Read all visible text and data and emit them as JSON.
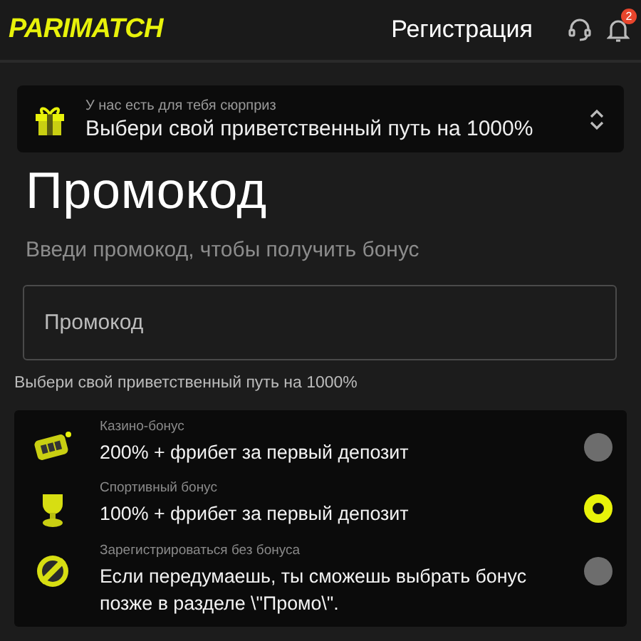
{
  "header": {
    "logo": "PARIMATCH",
    "register": "Регистрация",
    "notifications_badge": "2"
  },
  "banner": {
    "caption": "У нас есть для тебя сюрприз",
    "title": "Выбери свой приветственный путь на 1000%"
  },
  "title": "Промокод",
  "subtitle": "Введи промокод, чтобы получить бонус",
  "promo_field": {
    "placeholder": "Промокод"
  },
  "options_label": "Выбери свой приветственный путь на 1000%",
  "options": [
    {
      "kind": "casino",
      "caption": "Казино-бонус",
      "text": "200% + фрибет за первый депозит",
      "selected": false
    },
    {
      "kind": "sport",
      "caption": "Спортивный бонус",
      "text": "100% + фрибет за первый депозит",
      "selected": true
    },
    {
      "kind": "none",
      "caption": "Зарегистрироваться без бонуса",
      "text": "Если передумаешь, ты сможешь выбрать бонус позже в разделе \\\"Промо\\\".",
      "selected": false
    }
  ]
}
